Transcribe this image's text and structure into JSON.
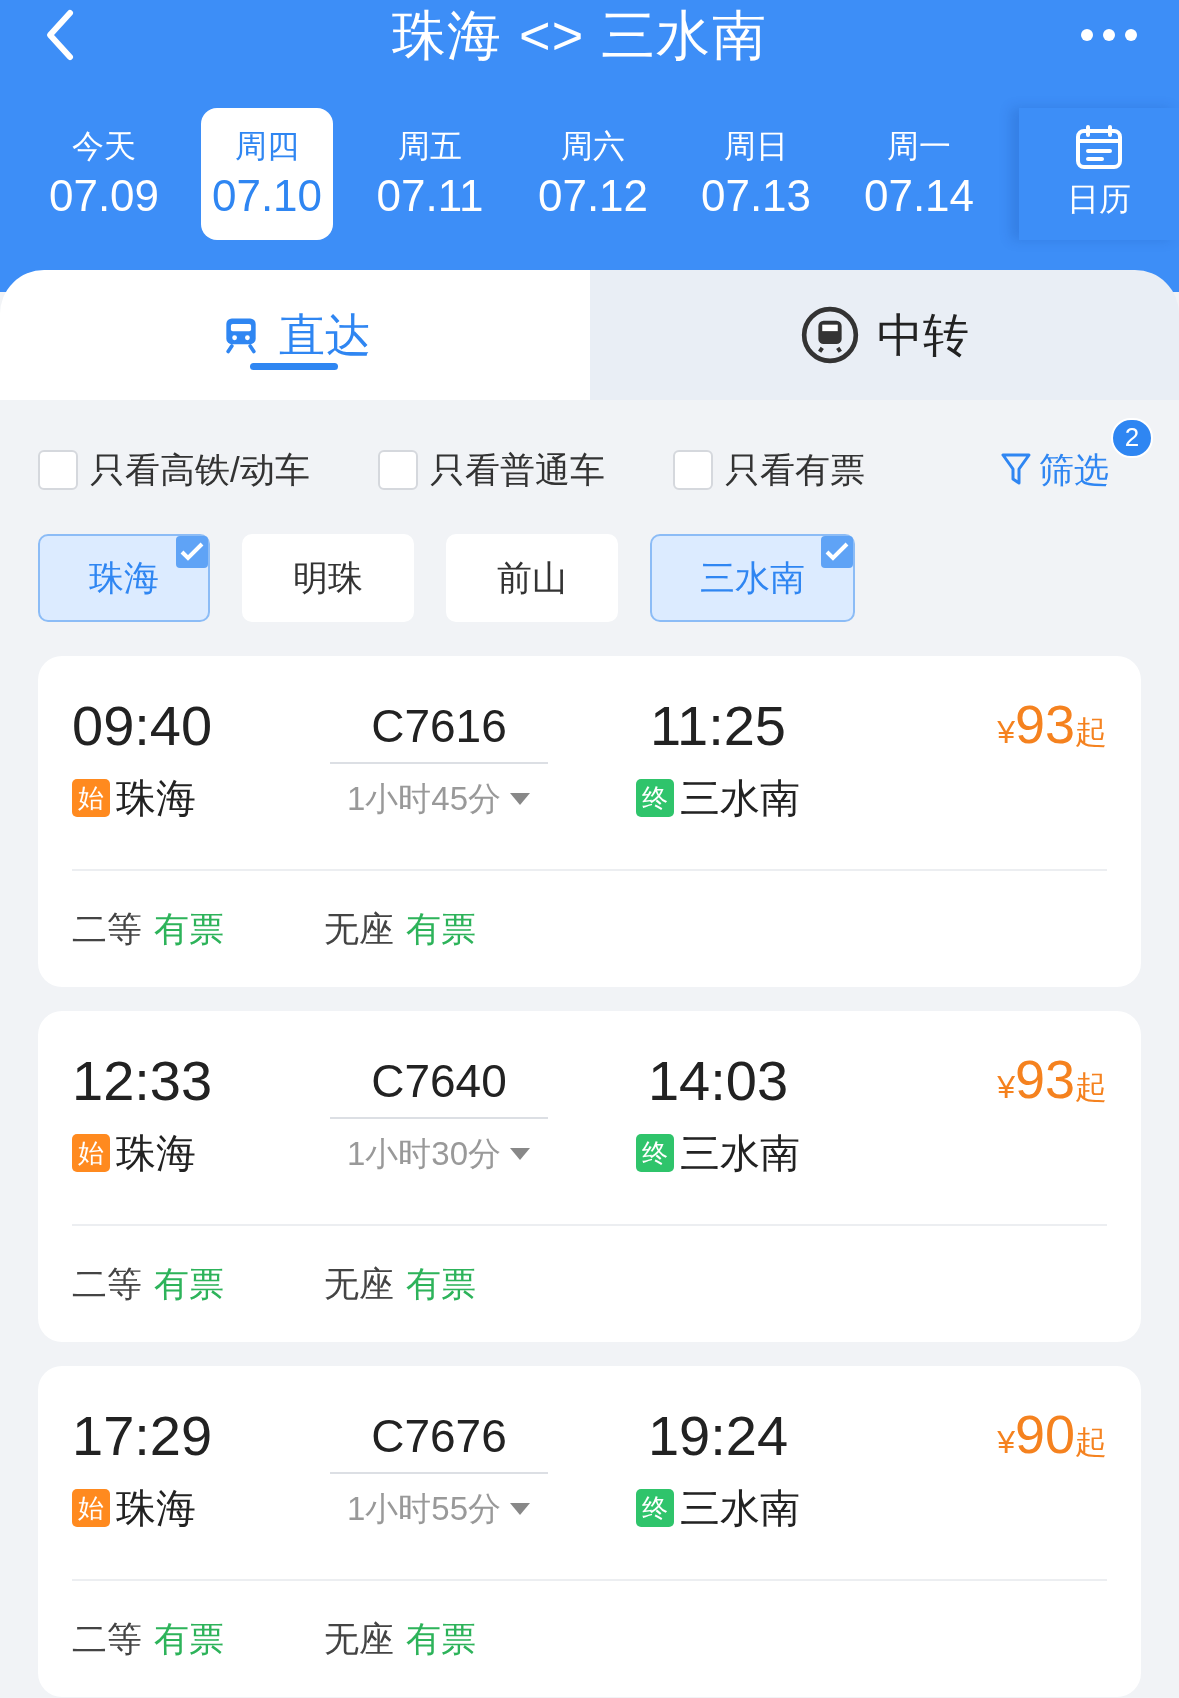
{
  "header": {
    "title": "珠海 <> 三水南"
  },
  "dates": [
    {
      "weekday": "今天",
      "date": "07.09",
      "selected": false
    },
    {
      "weekday": "周四",
      "date": "07.10",
      "selected": true
    },
    {
      "weekday": "周五",
      "date": "07.11",
      "selected": false
    },
    {
      "weekday": "周六",
      "date": "07.12",
      "selected": false
    },
    {
      "weekday": "周日",
      "date": "07.13",
      "selected": false
    },
    {
      "weekday": "周一",
      "date": "07.14",
      "selected": false
    }
  ],
  "calendar": {
    "label": "日历"
  },
  "modes": [
    {
      "kind": "direct",
      "label": "直达",
      "selected": true
    },
    {
      "kind": "transfer",
      "label": "中转",
      "selected": false
    }
  ],
  "filters": [
    {
      "label": "只看高铁/动车",
      "checked": false
    },
    {
      "label": "只看普通车",
      "checked": false
    },
    {
      "label": "只看有票",
      "checked": false
    }
  ],
  "filter_button": {
    "label": "筛选",
    "badge": "2"
  },
  "stations": [
    {
      "label": "珠海",
      "selected": true
    },
    {
      "label": "明珠",
      "selected": false
    },
    {
      "label": "前山",
      "selected": false
    },
    {
      "label": "三水南",
      "selected": true
    }
  ],
  "trains": [
    {
      "depart_time": "09:40",
      "origin_tag": "始",
      "origin": "珠海",
      "number": "C7616",
      "duration": "1小时45分",
      "arrive_time": "11:25",
      "terminal_tag": "终",
      "destination": "三水南",
      "price_symbol": "¥",
      "price": "93",
      "price_suffix": "起",
      "seats": [
        {
          "class": "二等",
          "availability": "有票"
        },
        {
          "class": "无座",
          "availability": "有票"
        }
      ]
    },
    {
      "depart_time": "12:33",
      "origin_tag": "始",
      "origin": "珠海",
      "number": "C7640",
      "duration": "1小时30分",
      "arrive_time": "14:03",
      "terminal_tag": "终",
      "destination": "三水南",
      "price_symbol": "¥",
      "price": "93",
      "price_suffix": "起",
      "seats": [
        {
          "class": "二等",
          "availability": "有票"
        },
        {
          "class": "无座",
          "availability": "有票"
        }
      ]
    },
    {
      "depart_time": "17:29",
      "origin_tag": "始",
      "origin": "珠海",
      "number": "C7676",
      "duration": "1小时55分",
      "arrive_time": "19:24",
      "terminal_tag": "终",
      "destination": "三水南",
      "price_symbol": "¥",
      "price": "90",
      "price_suffix": "起",
      "seats": [
        {
          "class": "二等",
          "availability": "有票"
        },
        {
          "class": "无座",
          "availability": "有票"
        }
      ]
    }
  ]
}
